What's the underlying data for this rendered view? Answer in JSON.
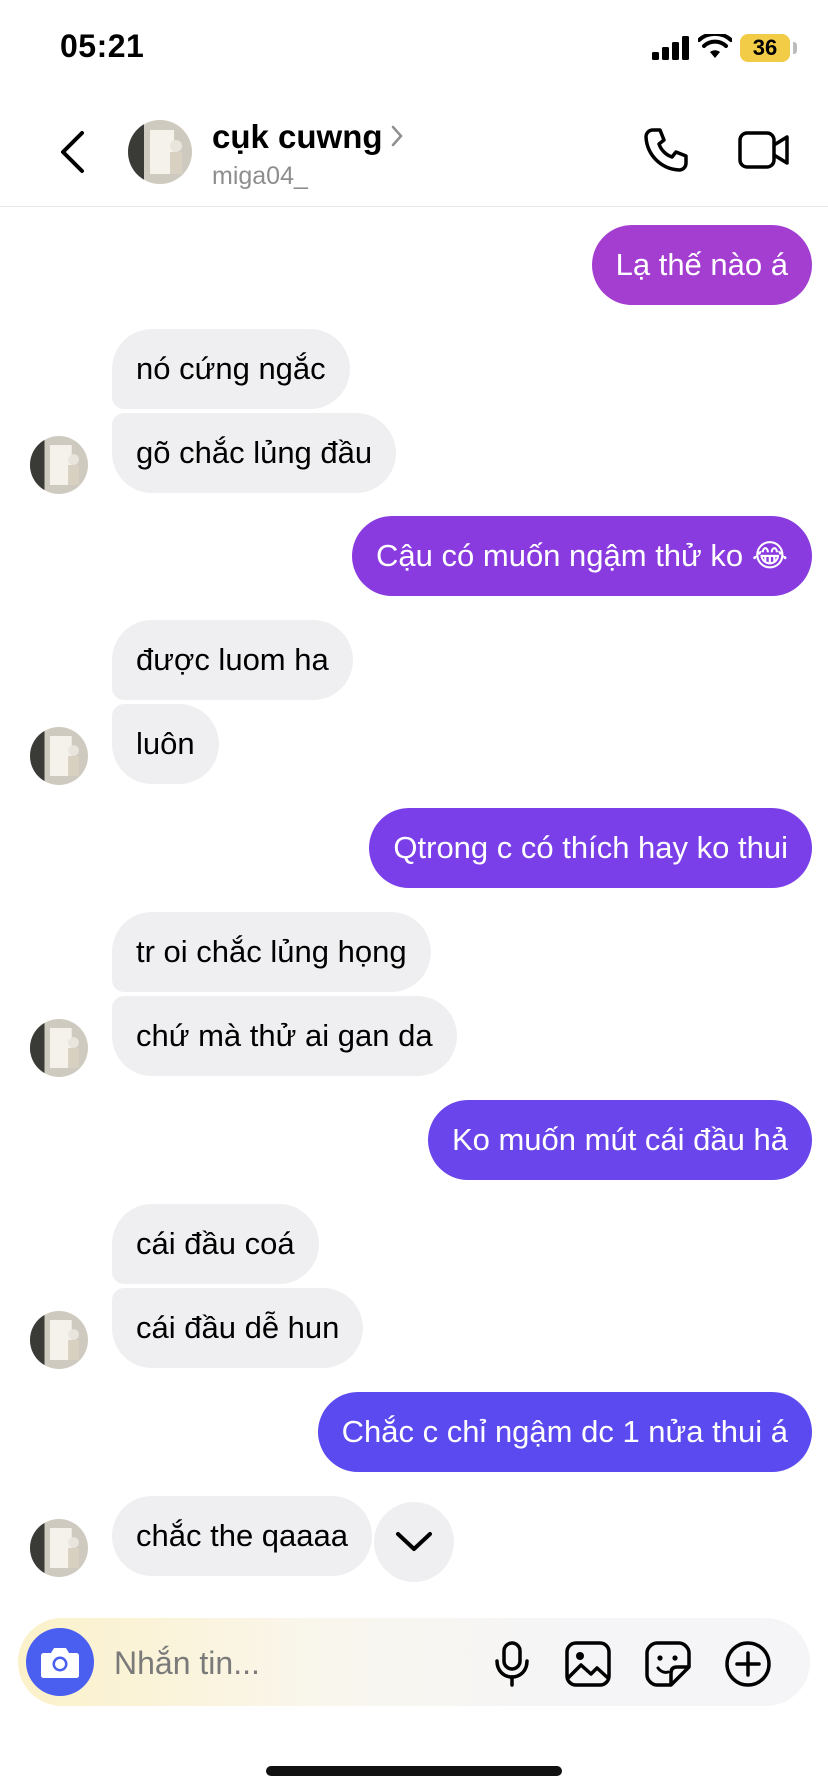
{
  "status_bar": {
    "time": "05:21",
    "battery": "36"
  },
  "header": {
    "name": "cụk cuwng",
    "username": "miga04_"
  },
  "messages": [
    {
      "dir": "out",
      "text": "Lạ thế nào á",
      "color": "#a33ed1"
    },
    {
      "dir": "in",
      "text": "nó cứng ngắc"
    },
    {
      "dir": "in",
      "text": "gõ chắc lủng đầu"
    },
    {
      "dir": "out",
      "text": "Cậu có muốn ngậm thử ko 😂",
      "color": "#8a3be0"
    },
    {
      "dir": "in",
      "text": "được luom ha"
    },
    {
      "dir": "in",
      "text": "luôn"
    },
    {
      "dir": "out",
      "text": "Qtrong c có thích hay ko thui",
      "color": "#7a3fe8"
    },
    {
      "dir": "in",
      "text": "tr oi chắc lủng họng"
    },
    {
      "dir": "in",
      "text": "chứ mà thử ai gan da"
    },
    {
      "dir": "out",
      "text": "Ko muốn mút cái đầu hả",
      "color": "#6a45ec"
    },
    {
      "dir": "in",
      "text": "cái đầu coá"
    },
    {
      "dir": "in",
      "text": "cái đầu dễ hun"
    },
    {
      "dir": "out",
      "text": "Chắc c chỉ ngậm dc 1 nửa thui á",
      "color": "#5a4aef"
    },
    {
      "dir": "in",
      "text": "chắc the qaaaa"
    }
  ],
  "composer": {
    "placeholder": "Nhắn tin..."
  },
  "icons": {
    "back": "chevron-left-icon",
    "call": "phone-icon",
    "video": "video-camera-icon",
    "camera": "camera-icon",
    "mic": "microphone-icon",
    "gallery": "image-icon",
    "sticker": "sticker-icon",
    "more": "plus-circle-icon",
    "scroll": "chevron-down-icon"
  }
}
